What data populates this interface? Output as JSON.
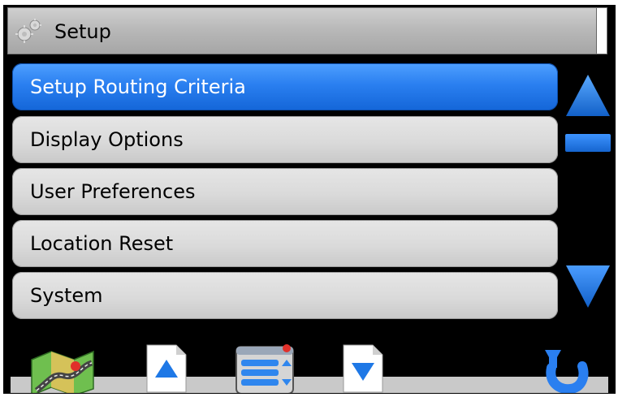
{
  "title_bar": {
    "title": "Setup",
    "icon": "gears-icon"
  },
  "menu": {
    "items": [
      {
        "label": "Setup Routing Criteria",
        "selected": true
      },
      {
        "label": "Display Options",
        "selected": false
      },
      {
        "label": "User Preferences",
        "selected": false
      },
      {
        "label": "Location Reset",
        "selected": false
      },
      {
        "label": "System",
        "selected": false
      }
    ]
  },
  "scrollbar": {
    "up_icon": "triangle-up-icon",
    "down_icon": "triangle-down-icon"
  },
  "toolbar": {
    "buttons": [
      {
        "icon": "map-icon"
      },
      {
        "icon": "page-up-icon"
      },
      {
        "icon": "list-menu-icon"
      },
      {
        "icon": "page-down-icon"
      },
      {
        "icon": "back-arrow-icon"
      }
    ]
  },
  "colors": {
    "accent": "#2a7ff0",
    "accent_dark": "#1466d8",
    "button_gray": "#dadada",
    "titlebar_gray": "#b9b9b9",
    "background": "#000000"
  }
}
